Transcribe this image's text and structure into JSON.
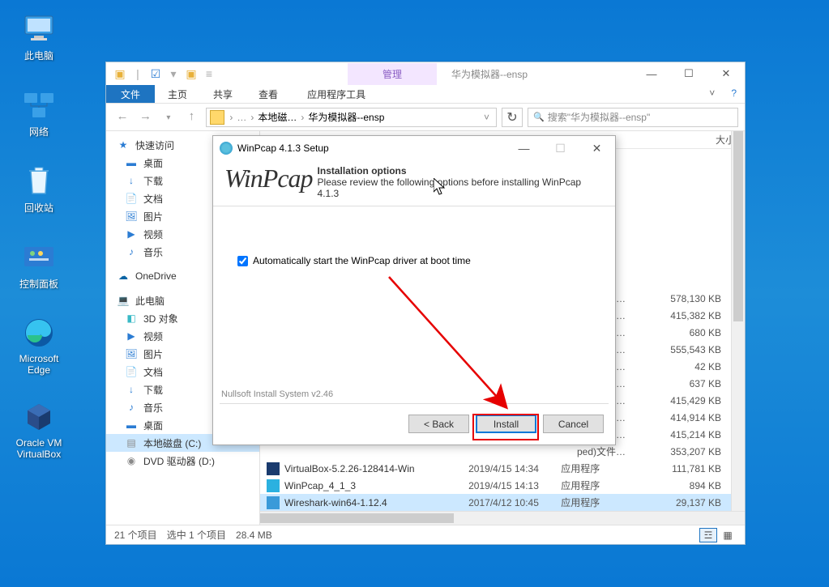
{
  "desktop": {
    "icons": [
      {
        "label": "此电脑",
        "glyph": "computer"
      },
      {
        "label": "网络",
        "glyph": "network"
      },
      {
        "label": "回收站",
        "glyph": "trash"
      },
      {
        "label": "控制面板",
        "glyph": "control"
      },
      {
        "label": "Microsoft Edge",
        "glyph": "edge"
      },
      {
        "label": "Oracle VM VirtualBox",
        "glyph": "vbox"
      }
    ]
  },
  "explorer": {
    "manage_label": "管理",
    "window_title": "华为模拟器--ensp",
    "tabs": {
      "file": "文件",
      "home": "主页",
      "share": "共享",
      "view": "查看",
      "tool": "应用程序工具"
    },
    "path": {
      "seg1": "本地磁…",
      "seg2": "华为模拟器--ensp"
    },
    "search_placeholder": "搜索\"华为模拟器--ensp\"",
    "headers": {
      "size": "大小"
    },
    "sidebar": [
      {
        "label": "快速访问",
        "bold": true,
        "ico": "★",
        "color": "#2b7cd3"
      },
      {
        "label": "桌面",
        "ico": "▬",
        "color": "#2b7cd3"
      },
      {
        "label": "下载",
        "ico": "↓",
        "color": "#2b7cd3"
      },
      {
        "label": "文档",
        "ico": "📄",
        "color": "#2b7cd3"
      },
      {
        "label": "图片",
        "ico": "🖼",
        "color": "#2b7cd3"
      },
      {
        "label": "视频",
        "ico": "▶",
        "color": "#2b7cd3"
      },
      {
        "label": "音乐",
        "ico": "♪",
        "color": "#2b7cd3"
      },
      {
        "label": "OneDrive",
        "bold": true,
        "ico": "☁",
        "color": "#0a64a4"
      },
      {
        "label": "此电脑",
        "bold": true,
        "ico": "💻",
        "color": "#2b7cd3"
      },
      {
        "label": "3D 对象",
        "ico": "◧",
        "color": "#39b9c6"
      },
      {
        "label": "视频",
        "ico": "▶",
        "color": "#2b7cd3"
      },
      {
        "label": "图片",
        "ico": "🖼",
        "color": "#2b7cd3"
      },
      {
        "label": "文档",
        "ico": "📄",
        "color": "#2b7cd3"
      },
      {
        "label": "下载",
        "ico": "↓",
        "color": "#2b7cd3"
      },
      {
        "label": "音乐",
        "ico": "♪",
        "color": "#2b7cd3"
      },
      {
        "label": "桌面",
        "ico": "▬",
        "color": "#2b7cd3"
      },
      {
        "label": "本地磁盘 (C:)",
        "ico": "▤",
        "color": "#8a8a8a",
        "selected": true
      },
      {
        "label": "DVD 驱动器 (D:)",
        "ico": "◉",
        "color": "#8a8a8a"
      }
    ],
    "partial_rows": [
      {
        "type": "ped)文件…",
        "size": "578,130 KB"
      },
      {
        "type": "ped)文件…",
        "size": "415,382 KB"
      },
      {
        "type": "ped)文件…",
        "size": "680 KB"
      },
      {
        "type": "ped)文件…",
        "size": "555,543 KB"
      },
      {
        "type": "ped)文件…",
        "size": "42 KB"
      },
      {
        "type": "ped)文件…",
        "size": "637 KB"
      },
      {
        "type": "ped)文件…",
        "size": "415,429 KB"
      },
      {
        "type": "ped)文件…",
        "size": "414,914 KB"
      },
      {
        "type": "ped)文件…",
        "size": "415,214 KB"
      },
      {
        "type": "ped)文件…",
        "size": "353,207 KB"
      }
    ],
    "visible_rows": [
      {
        "name": "VirtualBox-5.2.26-128414-Win",
        "date": "2019/4/15 14:34",
        "type": "应用程序",
        "size": "111,781 KB",
        "ico": "vbox"
      },
      {
        "name": "WinPcap_4_1_3",
        "date": "2019/4/15 14:13",
        "type": "应用程序",
        "size": "894 KB",
        "ico": "shield"
      },
      {
        "name": "Wireshark-win64-1.12.4",
        "date": "2017/4/12 10:45",
        "type": "应用程序",
        "size": "29,137 KB",
        "ico": "shark",
        "selected": true
      }
    ],
    "status": {
      "count": "21 个项目",
      "selection": "选中 1 个项目",
      "size": "28.4 MB"
    }
  },
  "installer": {
    "title": "WinPcap 4.1.3 Setup",
    "logo": "WinPcap",
    "heading": "Installation options",
    "subtext": "Please review the following options before installing WinPcap 4.1.3",
    "checkbox_label": "Automatically start the WinPcap driver at boot time",
    "checkbox_checked": true,
    "footer": "Nullsoft Install System v2.46",
    "buttons": {
      "back": "< Back",
      "install": "Install",
      "cancel": "Cancel"
    }
  }
}
